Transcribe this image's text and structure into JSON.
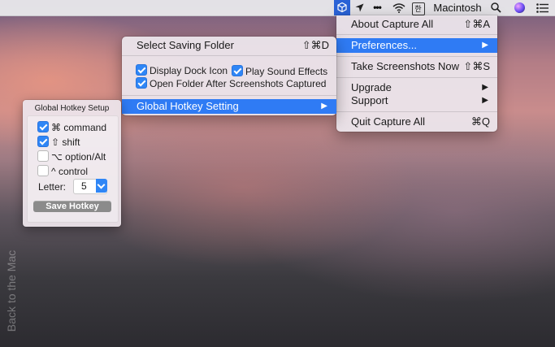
{
  "menubar": {
    "app_icon": "capture-all-cube-icon",
    "location_icon": "location-arrow-icon",
    "dots": "•••",
    "wifi_icon": "wifi-icon",
    "input_source": "한",
    "host": "Macintosh",
    "search_icon": "magnifier-icon",
    "siri_icon": "siri-icon",
    "notification_icon": "notification-list-icon"
  },
  "main_menu": {
    "about": "About Capture All",
    "about_shortcut": "⇧⌘A",
    "preferences": "Preferences...",
    "take_screenshots": "Take Screenshots Now",
    "take_shortcut": "⇧⌘S",
    "upgrade": "Upgrade",
    "support": "Support",
    "quit": "Quit Capture All",
    "quit_shortcut": "⌘Q",
    "submenu_arrow": "▶"
  },
  "preferences_menu": {
    "select_folder": "Select Saving Folder",
    "select_folder_shortcut": "⇧⌘D",
    "display_dock_icon": "Display Dock Icon",
    "play_sound": "Play Sound Effects",
    "open_folder": "Open Folder After Screenshots Captured",
    "global_hotkey": "Global Hotkey Setting",
    "submenu_arrow": "▶"
  },
  "hotkey_panel": {
    "title": "Global Hotkey Setup",
    "command": "⌘ command",
    "shift": "⇧ shift",
    "option": "⌥ option/Alt",
    "control": "^ control",
    "letter_label": "Letter:",
    "letter_value": "5",
    "save_button": "Save Hotkey"
  },
  "watermark": "Back to the Mac",
  "colors": {
    "accent": "#2f7bf4",
    "menubar": "#ececee"
  }
}
